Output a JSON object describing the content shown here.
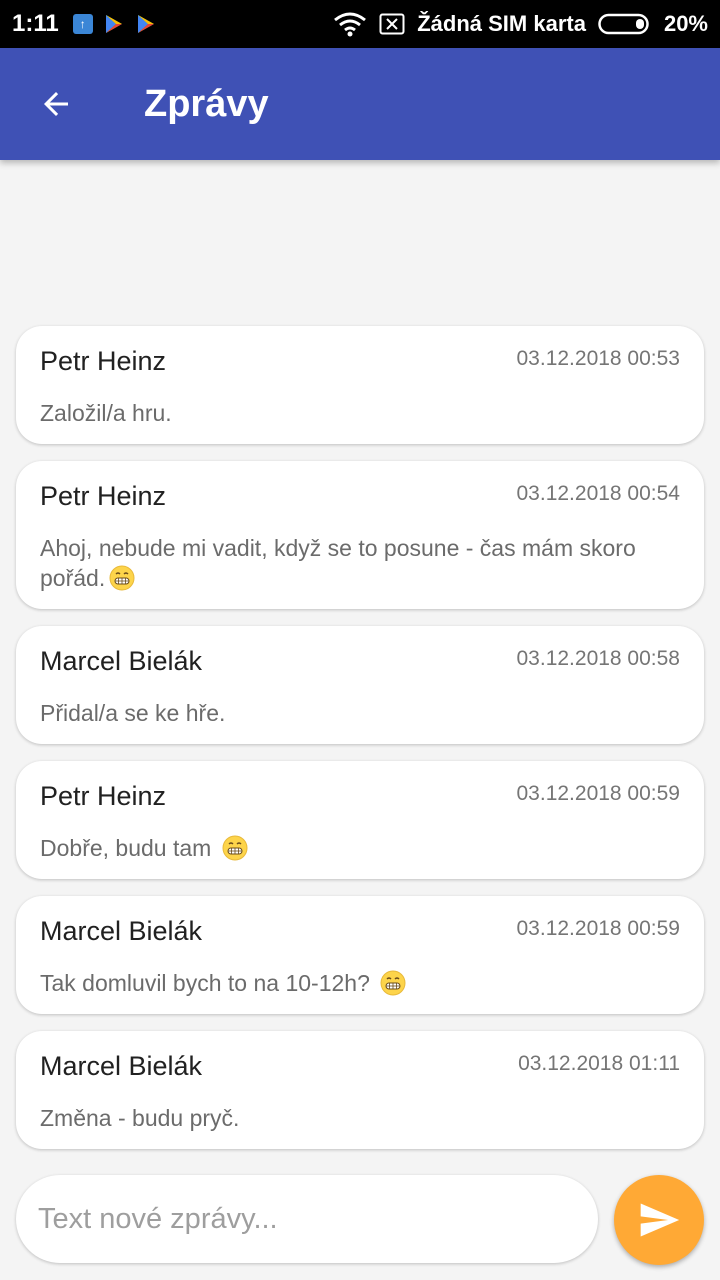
{
  "status_bar": {
    "time": "1:11",
    "carrier": "Žádná SIM karta",
    "battery": "20%"
  },
  "app_bar": {
    "title": "Zprávy",
    "color": "#3f51b5"
  },
  "messages": [
    {
      "author": "Petr Heinz",
      "date": "03.12.2018 00:53",
      "text": "Založil/a hru.",
      "emoji": false
    },
    {
      "author": "Petr Heinz",
      "date": "03.12.2018 00:54",
      "text": "Ahoj, nebude mi vadit, když se to posune - čas mám skoro pořád.",
      "emoji": true
    },
    {
      "author": "Marcel Bielák",
      "date": "03.12.2018 00:58",
      "text": "Přidal/a se ke hře.",
      "emoji": false
    },
    {
      "author": "Petr Heinz",
      "date": "03.12.2018 00:59",
      "text": "Dobře, budu tam",
      "emoji": true
    },
    {
      "author": "Marcel Bielák",
      "date": "03.12.2018 00:59",
      "text": "Tak domluvil bych to na 10-12h?",
      "emoji": true
    },
    {
      "author": "Marcel Bielák",
      "date": "03.12.2018 01:11",
      "text": "Změna - budu pryč.",
      "emoji": false
    }
  ],
  "composer": {
    "placeholder": "Text nové zprávy...",
    "value": ""
  },
  "send_button": {
    "icon": "send-icon",
    "color": "#ffa935"
  }
}
